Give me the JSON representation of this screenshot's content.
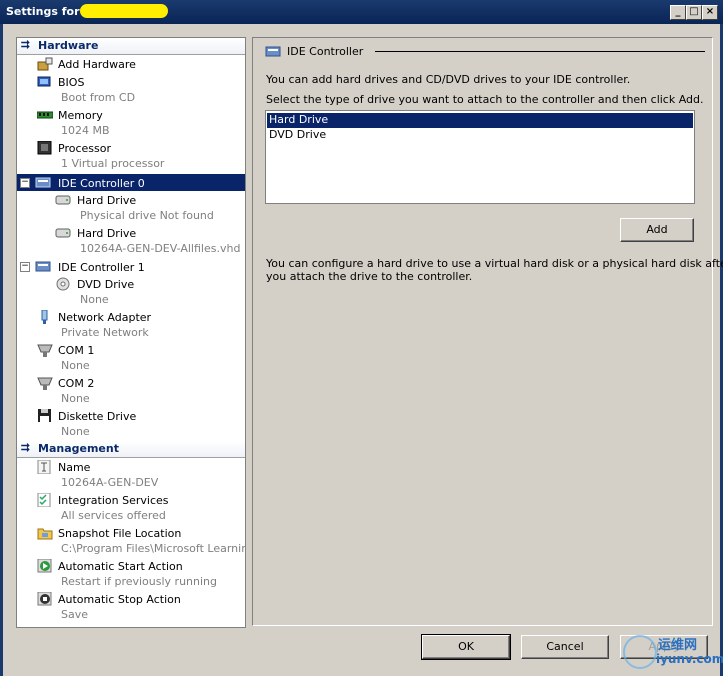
{
  "window": {
    "title": "Settings for",
    "min_label": "_",
    "max_label": "□",
    "close_label": "×"
  },
  "sidebar": {
    "hardware_header": "Hardware",
    "management_header": "Management",
    "items": [
      {
        "name": "Add Hardware",
        "sub": ""
      },
      {
        "name": "BIOS",
        "sub": "Boot from CD"
      },
      {
        "name": "Memory",
        "sub": "1024 MB"
      },
      {
        "name": "Processor",
        "sub": "1 Virtual processor"
      },
      {
        "name": "IDE Controller 0",
        "sub": ""
      },
      {
        "name": "Hard Drive",
        "sub": "Physical  drive Not found"
      },
      {
        "name": "Hard Drive",
        "sub": "10264A-GEN-DEV-Allfiles.vhd"
      },
      {
        "name": "IDE Controller 1",
        "sub": ""
      },
      {
        "name": "DVD Drive",
        "sub": "None"
      },
      {
        "name": "Network Adapter",
        "sub": "Private Network"
      },
      {
        "name": "COM 1",
        "sub": "None"
      },
      {
        "name": "COM 2",
        "sub": "None"
      },
      {
        "name": "Diskette Drive",
        "sub": "None"
      }
    ],
    "management_items": [
      {
        "name": "Name",
        "sub": "10264A-GEN-DEV"
      },
      {
        "name": "Integration Services",
        "sub": "All services offered"
      },
      {
        "name": "Snapshot File Location",
        "sub": "C:\\Program Files\\Microsoft Learnin..."
      },
      {
        "name": "Automatic Start Action",
        "sub": "Restart if previously running"
      },
      {
        "name": "Automatic Stop Action",
        "sub": "Save"
      }
    ]
  },
  "panel": {
    "title": "IDE Controller",
    "intro": "You can add hard drives and CD/DVD drives to your IDE controller.",
    "instruction": "Select the type of drive you want to attach to the controller and then click Add.",
    "options": [
      "Hard Drive",
      "DVD Drive"
    ],
    "selected_option": "Hard Drive",
    "add_label": "Add",
    "note_line1": "You can configure a hard drive to use a virtual hard disk or a physical hard disk after",
    "note_line2": "you attach the drive to the controller."
  },
  "footer": {
    "ok_label": "OK",
    "cancel_label": "Cancel",
    "apply_label": "Apply"
  },
  "watermark": {
    "text1": "运维网",
    "text2": "iyunv.com"
  }
}
